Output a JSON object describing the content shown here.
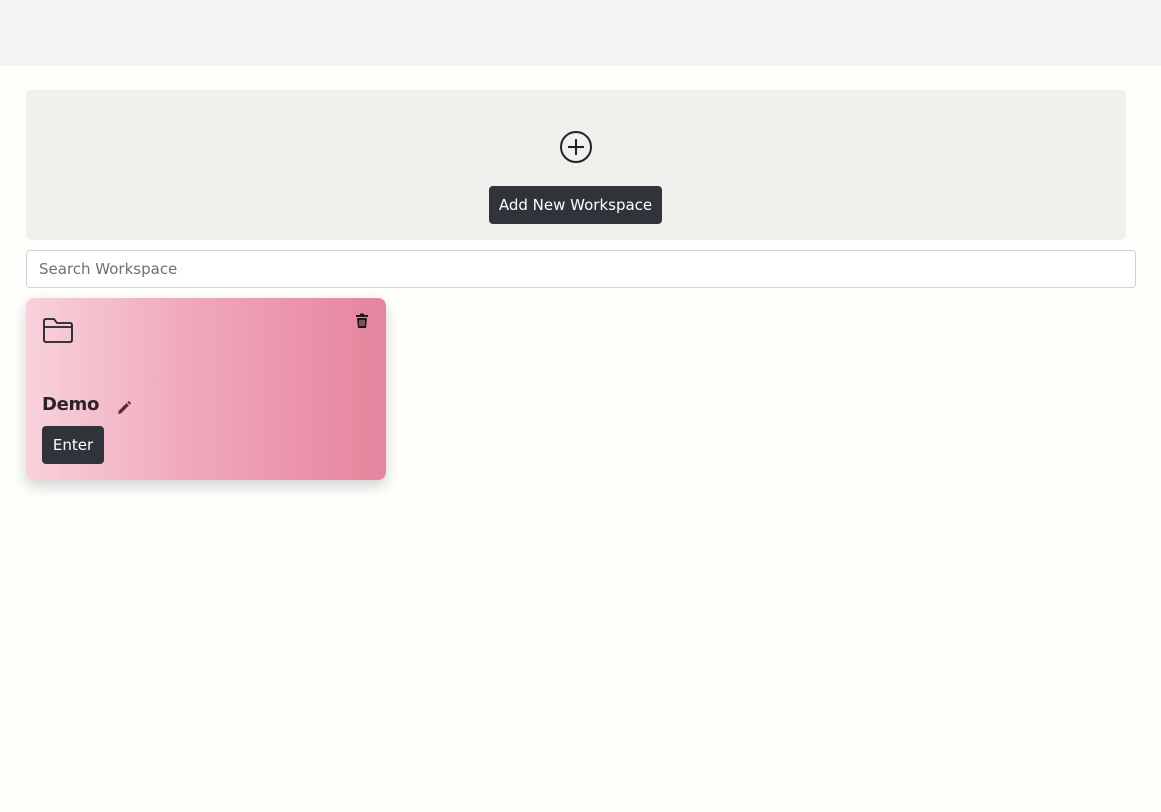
{
  "add_panel": {
    "icon": "plus-circle-icon",
    "button_label": "Add New Workspace"
  },
  "search": {
    "placeholder": "Search Workspace",
    "value": ""
  },
  "workspaces": [
    {
      "title": "Demo",
      "enter_label": "Enter",
      "folder_icon": "folder-icon",
      "delete_icon": "trash-icon",
      "edit_icon": "pencil-icon"
    }
  ],
  "colors": {
    "button_bg": "#30333a",
    "card_gradient_start": "#f8d2dc",
    "card_gradient_end": "#e6849e"
  }
}
